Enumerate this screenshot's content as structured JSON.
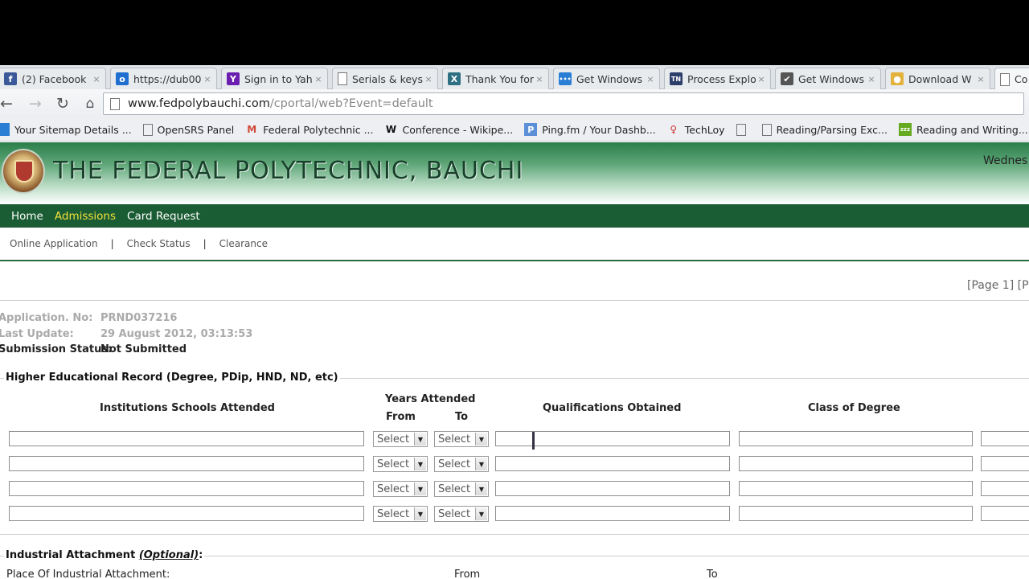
{
  "browser": {
    "tabs": [
      {
        "label": "(2) Facebook",
        "icon": "facebook-icon",
        "color": "#3b5998",
        "glyph": "f"
      },
      {
        "label": "https://dub00",
        "icon": "outlook-icon",
        "color": "#1f6fd1",
        "glyph": "o"
      },
      {
        "label": "Sign in to Yah",
        "icon": "yahoo-icon",
        "color": "#6b1fb1",
        "glyph": "Y"
      },
      {
        "label": "Serials & keys",
        "icon": "page-icon",
        "color": "",
        "glyph": ""
      },
      {
        "label": "Thank You for",
        "icon": "xbox-icon",
        "color": "#2f6f84",
        "glyph": "X"
      },
      {
        "label": "Get Windows",
        "icon": "dots-icon",
        "color": "#2a7fd4",
        "glyph": "•••"
      },
      {
        "label": "Process Explo",
        "icon": "tn-icon",
        "color": "#2c3f6a",
        "glyph": "TN"
      },
      {
        "label": "Get Windows",
        "icon": "windows-flag-icon",
        "color": "#555",
        "glyph": "✔"
      },
      {
        "label": "Download W",
        "icon": "bulb-icon",
        "color": "#e3b23c",
        "glyph": "●"
      },
      {
        "label": "Co",
        "icon": "page-icon",
        "color": "",
        "glyph": ""
      }
    ],
    "url_host": "www.fedpolybauchi.com",
    "url_path": "/cportal/web?Event=default",
    "bookmarks": [
      {
        "label": "Your Sitemap Details ...",
        "icon": "sitemap-icon"
      },
      {
        "label": "OpenSRS Panel",
        "icon": "page-icon"
      },
      {
        "label": "Federal Polytechnic ...",
        "icon": "gmail-icon"
      },
      {
        "label": "Conference - Wikipe...",
        "icon": "wikipedia-icon"
      },
      {
        "label": "Ping.fm / Your Dashb...",
        "icon": "pingfm-icon"
      },
      {
        "label": "TechLoy",
        "icon": "techloy-icon"
      },
      {
        "label": "",
        "icon": "page-icon"
      },
      {
        "label": "Reading/Parsing Exc...",
        "icon": "page-icon"
      },
      {
        "label": "Reading and Writing...",
        "icon": "zzz-icon"
      }
    ]
  },
  "site": {
    "title": "THE FEDERAL POLYTECHNIC, BAUCHI",
    "date": "Wednes",
    "nav": [
      "Home",
      "Admissions",
      "Card Request"
    ],
    "subnav": [
      "Online Application",
      "Check Status",
      "Clearance"
    ],
    "page_indicator": "[Page 1] [P"
  },
  "application": {
    "no_label": "Application. No:",
    "no_value": "PRND037216",
    "update_label": "Last Update:",
    "update_value": "29 August 2012, 03:13:53",
    "status_label": "Submission Status:",
    "status_value": "Not Submitted"
  },
  "higher_ed": {
    "legend": "Higher Educational Record (Degree, PDip, HND, ND, etc)",
    "col_institution": "Institutions Schools Attended",
    "col_years": "Years Attended",
    "col_from": "From",
    "col_to": "To",
    "col_qualifications": "Qualifications Obtained",
    "col_class": "Class of Degree",
    "select_placeholder": "Select"
  },
  "industrial": {
    "legend_prefix": "Industrial Attachment ",
    "legend_optional": "(Optional)",
    "legend_suffix": ":",
    "place_label": "Place Of Industrial Attachment:",
    "from_label": "From",
    "to_label": "To"
  }
}
